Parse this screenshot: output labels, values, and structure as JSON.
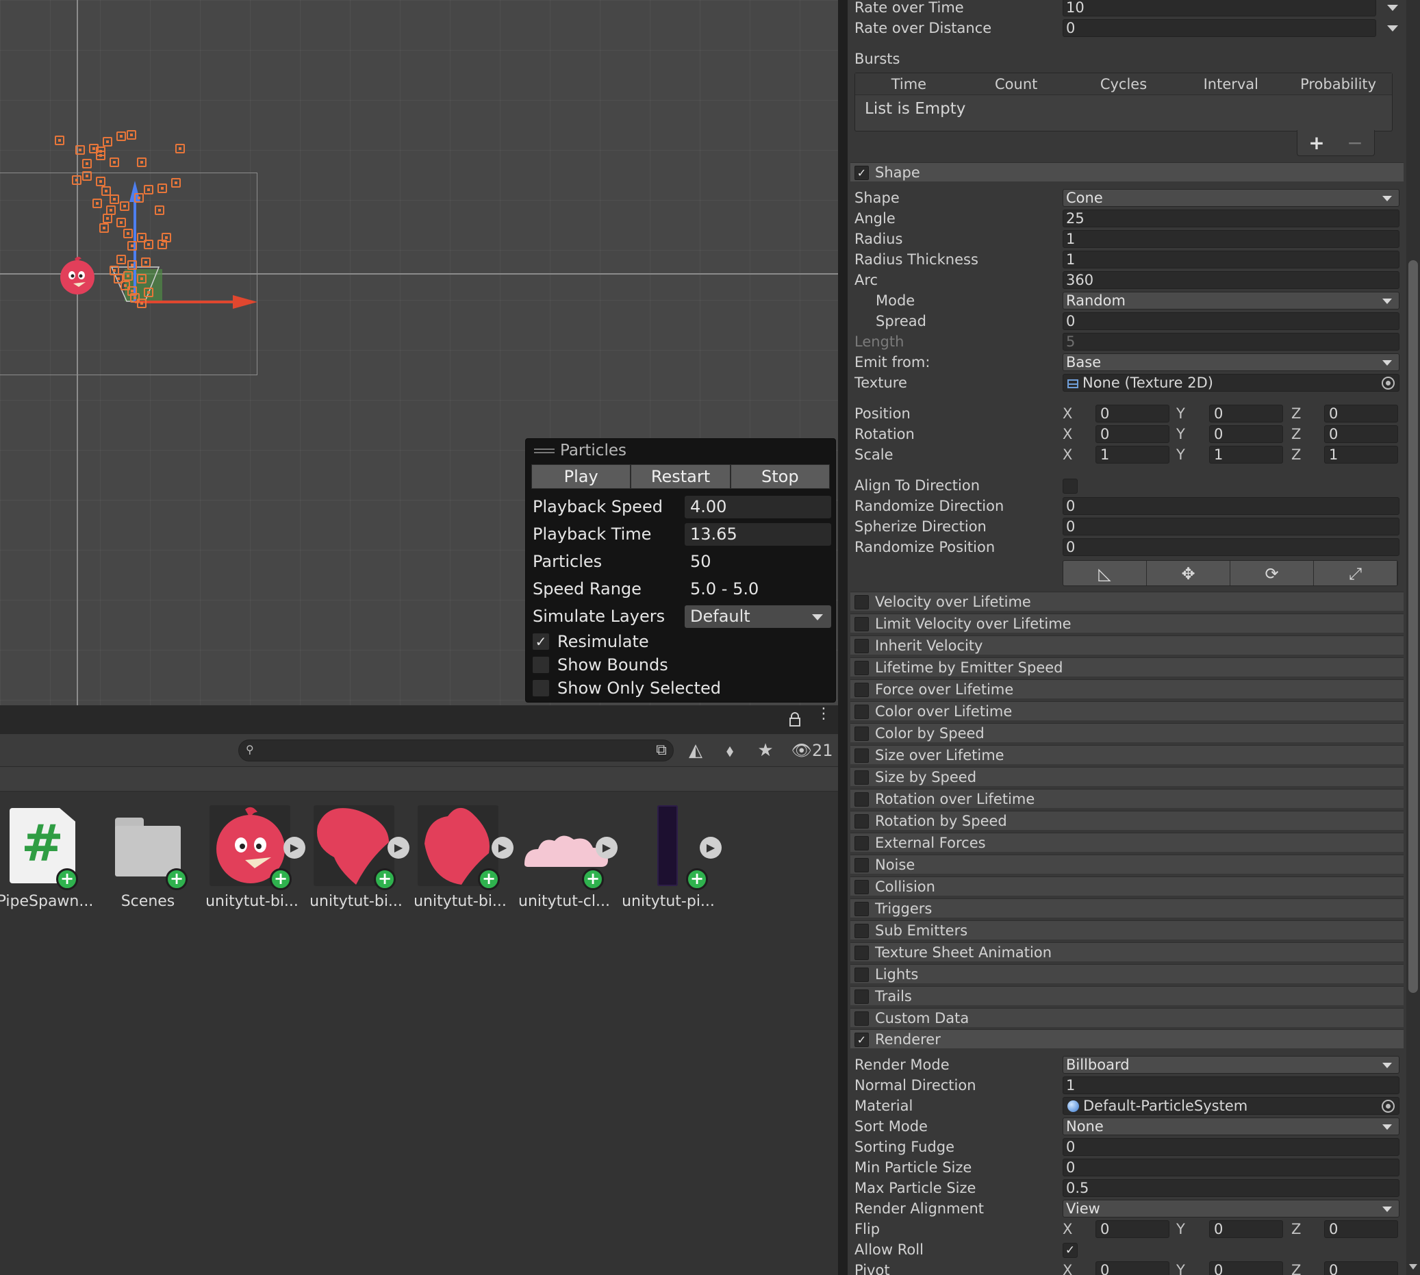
{
  "overlay": {
    "title": "Particles",
    "buttons": {
      "play": "Play",
      "restart": "Restart",
      "stop": "Stop"
    },
    "playback_speed": {
      "label": "Playback Speed",
      "value": "4.00"
    },
    "playback_time": {
      "label": "Playback Time",
      "value": "13.65"
    },
    "particles": {
      "label": "Particles",
      "value": "50"
    },
    "speed_range": {
      "label": "Speed Range",
      "value": "5.0 - 5.0"
    },
    "simulate_layers": {
      "label": "Simulate Layers",
      "value": "Default"
    },
    "resimulate": {
      "label": "Resimulate",
      "checked": true
    },
    "show_bounds": {
      "label": "Show Bounds",
      "checked": false
    },
    "show_only_selected": {
      "label": "Show Only Selected",
      "checked": false
    }
  },
  "project": {
    "hidden_count": "21",
    "assets": [
      {
        "label": "PipeSpawn...",
        "icon": "csharp-script-icon"
      },
      {
        "label": "Scenes",
        "icon": "folder-icon"
      },
      {
        "label": "unitytut-bi...",
        "icon": "bird-sprite-icon"
      },
      {
        "label": "unitytut-bi...",
        "icon": "wing-sprite-icon"
      },
      {
        "label": "unitytut-bi...",
        "icon": "wing-sprite-icon"
      },
      {
        "label": "unitytut-cl...",
        "icon": "cloud-sprite-icon"
      },
      {
        "label": "unitytut-pi...",
        "icon": "pipe-sprite-icon"
      }
    ]
  },
  "emission": {
    "rate_over_time": {
      "label": "Rate over Time",
      "value": "10"
    },
    "rate_over_distance": {
      "label": "Rate over Distance",
      "value": "0"
    },
    "bursts": {
      "label": "Bursts",
      "columns": [
        "Time",
        "Count",
        "Cycles",
        "Interval",
        "Probability"
      ],
      "empty_text": "List is Empty",
      "add": "+",
      "remove": "−"
    }
  },
  "shape_module": {
    "title": "Shape",
    "enabled": true,
    "shape": {
      "label": "Shape",
      "value": "Cone"
    },
    "angle": {
      "label": "Angle",
      "value": "25"
    },
    "radius": {
      "label": "Radius",
      "value": "1"
    },
    "radius_thickness": {
      "label": "Radius Thickness",
      "value": "1"
    },
    "arc": {
      "label": "Arc",
      "value": "360"
    },
    "mode": {
      "label": "Mode",
      "value": "Random"
    },
    "spread": {
      "label": "Spread",
      "value": "0"
    },
    "length": {
      "label": "Length",
      "value": "5"
    },
    "emit_from": {
      "label": "Emit from:",
      "value": "Base"
    },
    "texture": {
      "label": "Texture",
      "value": "None (Texture 2D)"
    },
    "position": {
      "label": "Position",
      "x": "0",
      "y": "0",
      "z": "0"
    },
    "rotation": {
      "label": "Rotation",
      "x": "0",
      "y": "0",
      "z": "0"
    },
    "scale": {
      "label": "Scale",
      "x": "1",
      "y": "1",
      "z": "1"
    },
    "align_to_direction": {
      "label": "Align To Direction",
      "checked": false
    },
    "randomize_direction": {
      "label": "Randomize Direction",
      "value": "0"
    },
    "spherize_direction": {
      "label": "Spherize Direction",
      "value": "0"
    },
    "randomize_position": {
      "label": "Randomize Position",
      "value": "0"
    }
  },
  "axes": {
    "x": "X",
    "y": "Y",
    "z": "Z"
  },
  "modules": [
    {
      "label": "Velocity over Lifetime",
      "enabled": false
    },
    {
      "label": "Limit Velocity over Lifetime",
      "enabled": false
    },
    {
      "label": "Inherit Velocity",
      "enabled": false
    },
    {
      "label": "Lifetime by Emitter Speed",
      "enabled": false
    },
    {
      "label": "Force over Lifetime",
      "enabled": false
    },
    {
      "label": "Color over Lifetime",
      "enabled": false
    },
    {
      "label": "Color by Speed",
      "enabled": false
    },
    {
      "label": "Size over Lifetime",
      "enabled": false
    },
    {
      "label": "Size by Speed",
      "enabled": false
    },
    {
      "label": "Rotation over Lifetime",
      "enabled": false
    },
    {
      "label": "Rotation by Speed",
      "enabled": false
    },
    {
      "label": "External Forces",
      "enabled": false
    },
    {
      "label": "Noise",
      "enabled": false
    },
    {
      "label": "Collision",
      "enabled": false
    },
    {
      "label": "Triggers",
      "enabled": false
    },
    {
      "label": "Sub Emitters",
      "enabled": false
    },
    {
      "label": "Texture Sheet Animation",
      "enabled": false
    },
    {
      "label": "Lights",
      "enabled": false
    },
    {
      "label": "Trails",
      "enabled": false
    },
    {
      "label": "Custom Data",
      "enabled": false
    }
  ],
  "renderer": {
    "title": "Renderer",
    "enabled": true,
    "render_mode": {
      "label": "Render Mode",
      "value": "Billboard"
    },
    "normal_direction": {
      "label": "Normal Direction",
      "value": "1"
    },
    "material": {
      "label": "Material",
      "value": "Default-ParticleSystem"
    },
    "sort_mode": {
      "label": "Sort Mode",
      "value": "None"
    },
    "sorting_fudge": {
      "label": "Sorting Fudge",
      "value": "0"
    },
    "min_particle_size": {
      "label": "Min Particle Size",
      "value": "0"
    },
    "max_particle_size": {
      "label": "Max Particle Size",
      "value": "0.5"
    },
    "render_alignment": {
      "label": "Render Alignment",
      "value": "View"
    },
    "flip": {
      "label": "Flip",
      "x": "0",
      "y": "0",
      "z": "0"
    },
    "allow_roll": {
      "label": "Allow Roll",
      "checked": true
    },
    "pivot": {
      "label": "Pivot",
      "x": "0",
      "y": "0",
      "z": "0"
    }
  },
  "colors": {
    "accent_particle": "#e8763a",
    "toggle_on": "#2fb24e",
    "axis_x": "#e0472f",
    "axis_y": "#4e7ff0"
  }
}
